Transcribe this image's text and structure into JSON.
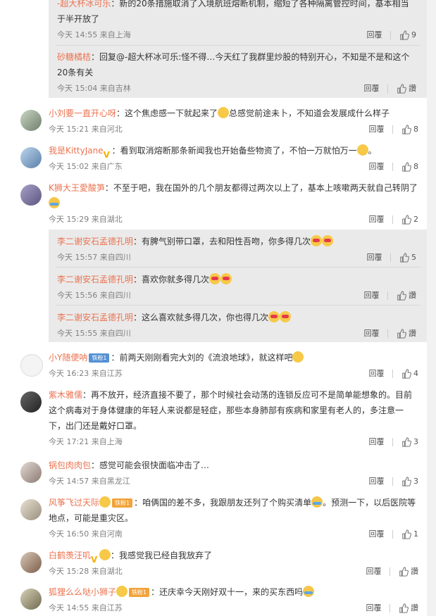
{
  "replies_top": [
    {
      "user": "-超大杯冰可乐",
      "text": "：新的20条措施取消了入境航班熔断机制，缩短了各种隔离管控时间，基本相当于半开放了",
      "time": "今天 14:55 来自上海",
      "reply_label": "回覆",
      "likes": "9"
    },
    {
      "user": "砂糖橘桔",
      "text": "：回复@-超大杯冰可乐:怪不得…今天红了我群里炒股的特别开心，不知是不是和这个20条有关",
      "time": "今天 15:04 来自吉林",
      "reply_label": "回覆",
      "likes": "讚"
    }
  ],
  "comments": [
    {
      "user": "小刘要一直开心呀",
      "text": "：这个焦虑感一下就起来了",
      "text2": "总感觉前途未卜，不知道会发展成什么样子",
      "time": "今天 15:21 来自河北",
      "reply_label": "回覆",
      "likes": "8"
    },
    {
      "user": "我是KittyJane",
      "text": "：看到取消熔断那条新闻我也开始备些物资了，不怕一万就怕万一",
      "tail": "。",
      "time": "今天 15:02 来自广东",
      "reply_label": "回覆",
      "likes": "8"
    },
    {
      "user": "K狮大王愛酸笋",
      "text": "：不至于吧，我在国外的几个朋友都得过两次以上了，基本上咳嗽两天就自己转阴了",
      "time": "今天 15:29 来自湖北",
      "reply_label": "回覆",
      "likes": "2"
    },
    {
      "user": "小Y随便呐",
      "badge": "铁粉1",
      "text": "：前两天刚刚看完大刘的《流浪地球》，就这样吧",
      "time": "今天 16:23 来自江苏",
      "reply_label": "回覆",
      "likes": "4"
    },
    {
      "user": "紫木雅儒",
      "text": "：再不放开，经济直接不要了，那个时候社会动荡的连锁反应可不是简单能想象的。目前这个病毒对于身体健康的年轻人来说都是轻症，那些本身肺部有疾病和家里有老人的，多注意一下，出门还是戴好口罩。",
      "time": "今天 17:21 来自上海",
      "reply_label": "回覆",
      "likes": "3"
    },
    {
      "user": "锅包肉肉包",
      "text": "：感觉可能会很快面临冲击了…",
      "time": "今天 14:57 来自黑龙江",
      "reply_label": "回覆",
      "likes": "3"
    },
    {
      "user": "风筝飞过天际",
      "badge": "铁粉1",
      "text": "：咱俩国的差不多，我跟朋友还列了个购买清单",
      "text2": "。预测一下，以后医院等地点，可能是重灾区。",
      "time": "今天 16:50 来自河南",
      "reply_label": "回覆",
      "likes": "1"
    },
    {
      "user": "白鹤羡汪叽",
      "text": "：我感觉我已经自我放弃了",
      "time": "今天 15:28 来自湖北",
      "reply_label": "回覆",
      "likes": "讚"
    },
    {
      "user": "狐狸么么哒小狮子",
      "badge": "铁粉1",
      "text": "：还庆幸今天刚好双十一，来的买东西吗",
      "time": "今天 14:55 来自江苏",
      "reply_label": "回覆",
      "likes": "讚"
    }
  ],
  "replies_k": [
    {
      "user": "李二谢安石孟德孔明",
      "text": "：有脾气别带口罩，去和阳性吾吻，你多得几次",
      "time": "今天 15:57 来自四川",
      "reply_label": "回覆",
      "likes": "5"
    },
    {
      "user": "李二谢安石孟德孔明",
      "text": "：喜欢你就多得几次",
      "time": "今天 15:56 来自四川",
      "reply_label": "回覆",
      "likes": "讚"
    },
    {
      "user": "李二谢安石孟德孔明",
      "text": "：这么喜欢就多得几次，你也得几次",
      "time": "今天 15:55 来自四川",
      "reply_label": "回覆",
      "likes": "讚"
    }
  ],
  "colors": {
    "username": "#eb7350",
    "meta": "#808080",
    "reply_bg": "#eaeaea"
  }
}
